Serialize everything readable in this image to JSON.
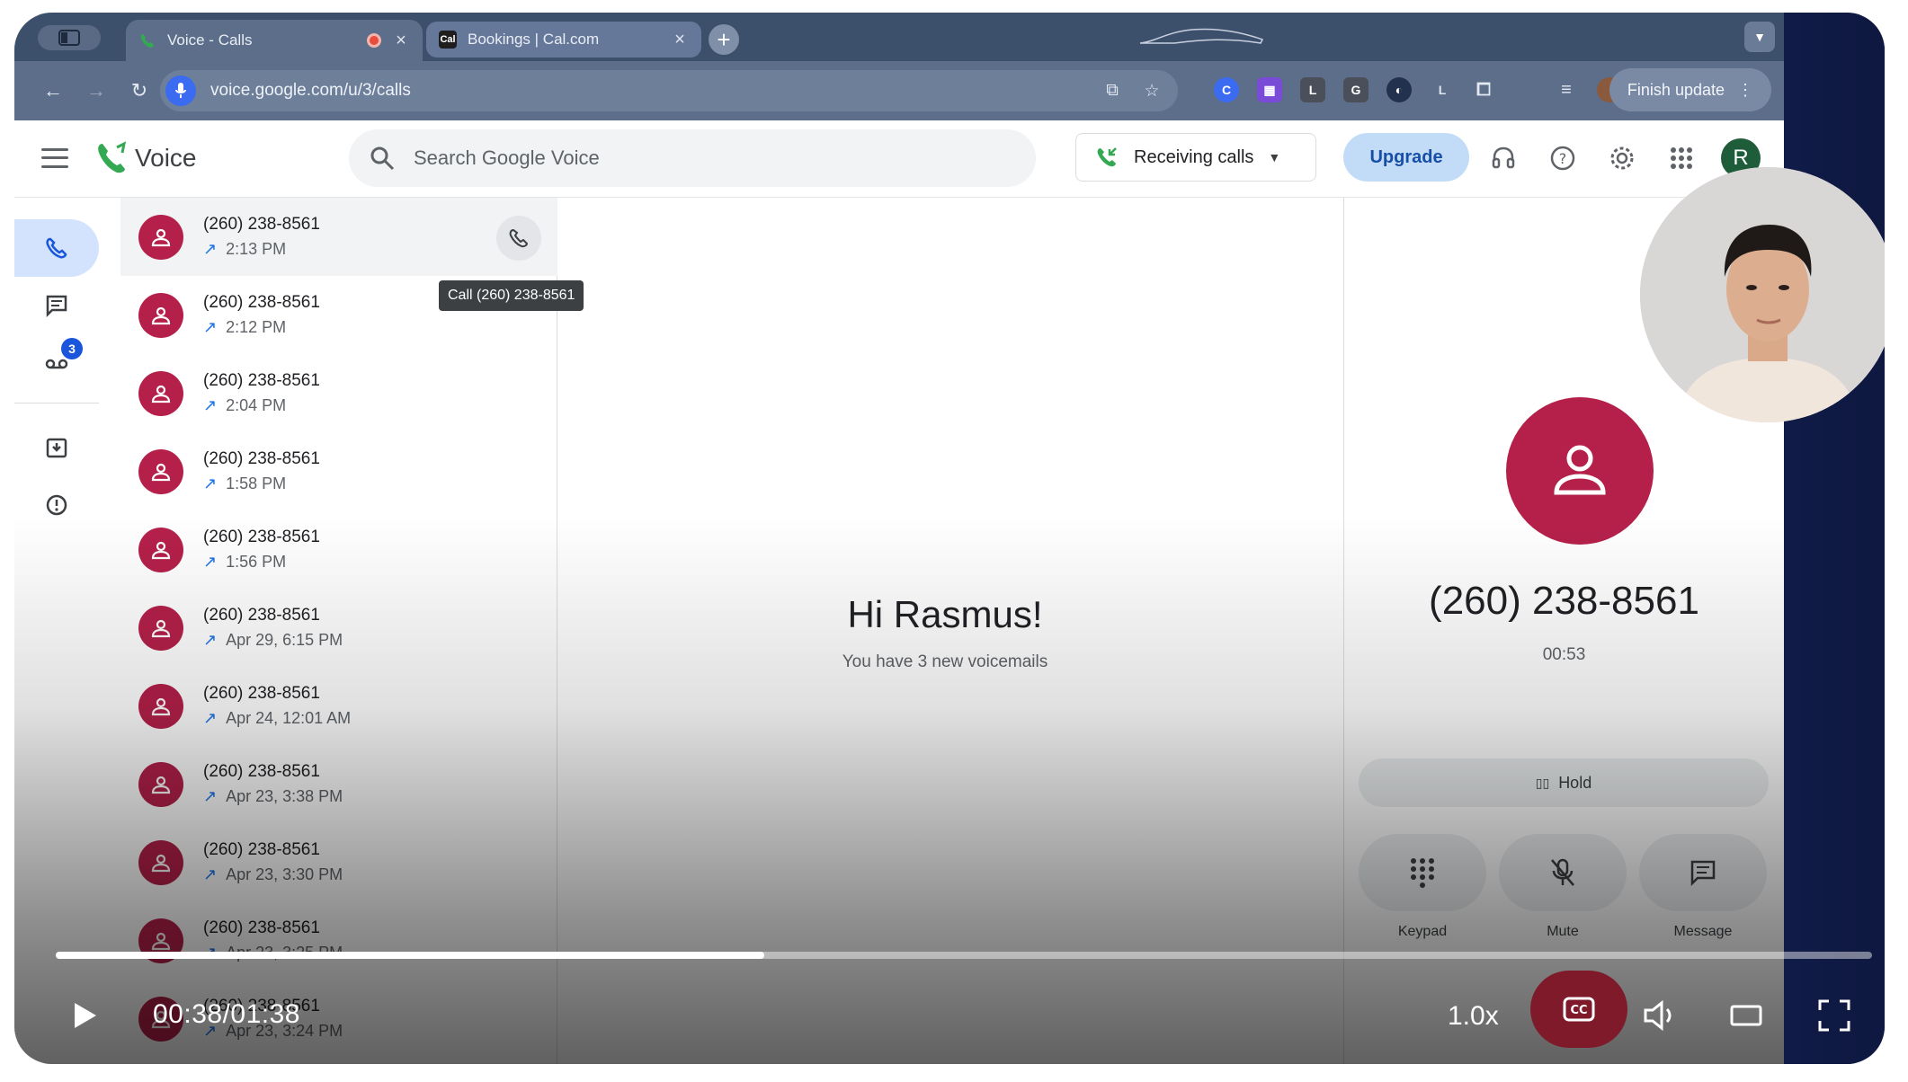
{
  "browser": {
    "tabs": [
      {
        "title": "Voice - Calls",
        "active": true
      },
      {
        "title": "Bookings | Cal.com",
        "active": false
      }
    ],
    "url": "voice.google.com/u/3/calls",
    "finish_update_label": "Finish update",
    "extensions": [
      "L",
      "G",
      "L"
    ]
  },
  "app": {
    "title": "Voice",
    "search_placeholder": "Search Google Voice",
    "receiving_label": "Receiving calls",
    "upgrade_label": "Upgrade",
    "account_initial": "R",
    "voicemail_badge": "3"
  },
  "calls": [
    {
      "number": "(260) 238-8561",
      "time": "2:13 PM"
    },
    {
      "number": "(260) 238-8561",
      "time": "2:12 PM"
    },
    {
      "number": "(260) 238-8561",
      "time": "2:04 PM"
    },
    {
      "number": "(260) 238-8561",
      "time": "1:58 PM"
    },
    {
      "number": "(260) 238-8561",
      "time": "1:56 PM"
    },
    {
      "number": "(260) 238-8561",
      "time": "Apr 29, 6:15 PM"
    },
    {
      "number": "(260) 238-8561",
      "time": "Apr 24, 12:01 AM"
    },
    {
      "number": "(260) 238-8561",
      "time": "Apr 23, 3:38 PM"
    },
    {
      "number": "(260) 238-8561",
      "time": "Apr 23, 3:30 PM"
    },
    {
      "number": "(260) 238-8561",
      "time": "Apr 23, 3:25 PM"
    },
    {
      "number": "(260) 238-8561",
      "time": "Apr 23, 3:24 PM"
    }
  ],
  "tooltip": "Call (260) 238-8561",
  "center": {
    "greeting": "Hi Rasmus!",
    "subtext": "You have 3 new voicemails"
  },
  "active_call": {
    "number": "(260) 238-8561",
    "timer": "00:53",
    "hold_label": "Hold",
    "keypad_label": "Keypad",
    "mute_label": "Mute",
    "message_label": "Message"
  },
  "player": {
    "current_time": "00:38",
    "separator": "/",
    "duration": "01:38",
    "progress": 0.39,
    "speed": "1.0x"
  },
  "colors": {
    "contact_avatar": "#b5204a",
    "accent_blue": "#1a73e8",
    "upgrade_bg": "#c2dcf7",
    "cc_active": "#7e1a2a"
  }
}
